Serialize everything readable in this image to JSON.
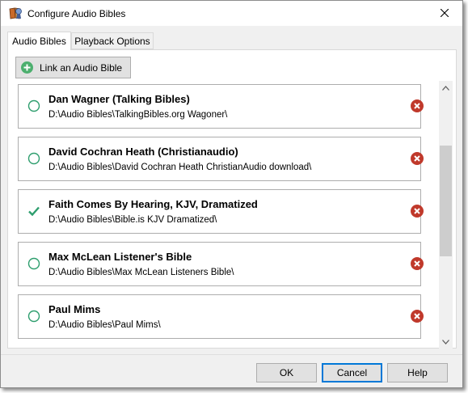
{
  "window": {
    "title": "Configure Audio Bibles"
  },
  "tabs": [
    {
      "label": "Audio Bibles",
      "active": true
    },
    {
      "label": "Playback Options",
      "active": false
    }
  ],
  "toolbar": {
    "link_label": "Link an Audio Bible"
  },
  "bibles": [
    {
      "name": "Dan Wagner (Talking Bibles)",
      "path": "D:\\Audio Bibles\\TalkingBibles.org Wagoner\\",
      "selected": false
    },
    {
      "name": "David Cochran Heath (Christianaudio)",
      "path": "D:\\Audio Bibles\\David Cochran Heath ChristianAudio download\\",
      "selected": false
    },
    {
      "name": "Faith Comes By Hearing, KJV, Dramatized",
      "path": "D:\\Audio Bibles\\Bible.is KJV Dramatized\\",
      "selected": true
    },
    {
      "name": "Max McLean Listener's Bible",
      "path": "D:\\Audio Bibles\\Max McLean Listeners Bible\\",
      "selected": false
    },
    {
      "name": "Paul Mims",
      "path": "D:\\Audio Bibles\\Paul Mims\\",
      "selected": false
    }
  ],
  "footer": {
    "ok_label": "OK",
    "cancel_label": "Cancel",
    "help_label": "Help"
  },
  "colors": {
    "accent": "#0078d7",
    "check": "#2e9e6e",
    "remove": "#c0392b"
  },
  "icons": {
    "app": "bible-app-icon",
    "add": "plus-circle-icon",
    "remove": "remove-x-circle-icon",
    "radio": "radio-empty-icon",
    "check": "checkmark-icon"
  }
}
